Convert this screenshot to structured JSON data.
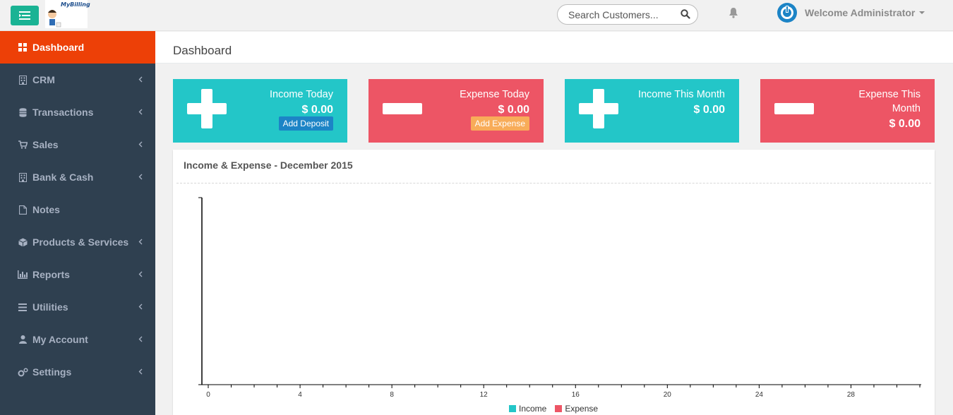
{
  "app": {
    "logo_text": "MyBilling",
    "search_placeholder": "Search Customers...",
    "welcome": "Welcome Administrator"
  },
  "sidebar": {
    "items": [
      {
        "label": "Dashboard",
        "icon": "th-large-icon",
        "active": true,
        "chevron": false
      },
      {
        "label": "CRM",
        "icon": "building-icon",
        "active": false,
        "chevron": true
      },
      {
        "label": "Transactions",
        "icon": "database-icon",
        "active": false,
        "chevron": true
      },
      {
        "label": "Sales",
        "icon": "cart-icon",
        "active": false,
        "chevron": true
      },
      {
        "label": "Bank & Cash",
        "icon": "building-icon",
        "active": false,
        "chevron": true
      },
      {
        "label": "Notes",
        "icon": "file-icon",
        "active": false,
        "chevron": false
      },
      {
        "label": "Products & Services",
        "icon": "cube-icon",
        "active": false,
        "chevron": true
      },
      {
        "label": "Reports",
        "icon": "bar-chart-icon",
        "active": false,
        "chevron": true
      },
      {
        "label": "Utilities",
        "icon": "bars-icon",
        "active": false,
        "chevron": true
      },
      {
        "label": "My Account",
        "icon": "user-icon",
        "active": false,
        "chevron": true
      },
      {
        "label": "Settings",
        "icon": "cogs-icon",
        "active": false,
        "chevron": true
      }
    ]
  },
  "page": {
    "title": "Dashboard"
  },
  "cards": [
    {
      "label": "Income Today",
      "value": "$ 0.00",
      "button": "Add Deposit"
    },
    {
      "label": "Expense Today",
      "value": "$ 0.00",
      "button": "Add Expense"
    },
    {
      "label": "Income This Month",
      "value": "$ 0.00"
    },
    {
      "label": "Expense This Month",
      "value": "$ 0.00"
    }
  ],
  "colors": {
    "teal": "#23c6c8",
    "red": "#ed5565",
    "sidebar": "#2f4050",
    "active": "#ed4007",
    "green": "#1ab394"
  },
  "panel": {
    "title": "Income & Expense - December 2015"
  },
  "chart_data": {
    "type": "line",
    "title": "Income & Expense - December 2015",
    "xlabel": "",
    "ylabel": "",
    "xlim": [
      0,
      31
    ],
    "x_tick_labels": [
      "0",
      "4",
      "8",
      "12",
      "16",
      "20",
      "24",
      "28"
    ],
    "series": [
      {
        "name": "Income",
        "color": "#23c6c8",
        "values": []
      },
      {
        "name": "Expense",
        "color": "#ed5565",
        "values": []
      }
    ],
    "grid": false,
    "legend": "bottom-center"
  }
}
